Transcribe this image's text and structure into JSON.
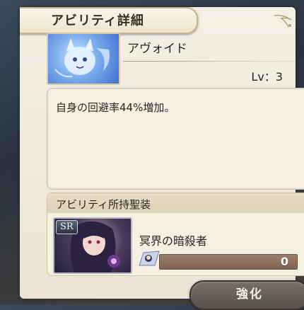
{
  "header": {
    "title": "アビリティ詳細"
  },
  "ability": {
    "name": "アヴォイド",
    "level": "Lv：3",
    "description": "自身の回避率44%増加。"
  },
  "equipment": {
    "title": "アビリティ所持聖装",
    "rarity": "SR",
    "name": "冥界の暗殺者",
    "exp_value": "0"
  },
  "actions": {
    "enhance_label": "強化"
  },
  "colors": {
    "panel": "#f4efe4",
    "exp_bar": "#8e7260",
    "button": "#6a605a",
    "ability_icon": "#6fa4ea"
  },
  "icons": {
    "ability": "ice-spirit-icon",
    "equipment": "assassin-character-card",
    "exp": "equipment-thumb-icon",
    "ornament": "corner-ornament-icon"
  }
}
